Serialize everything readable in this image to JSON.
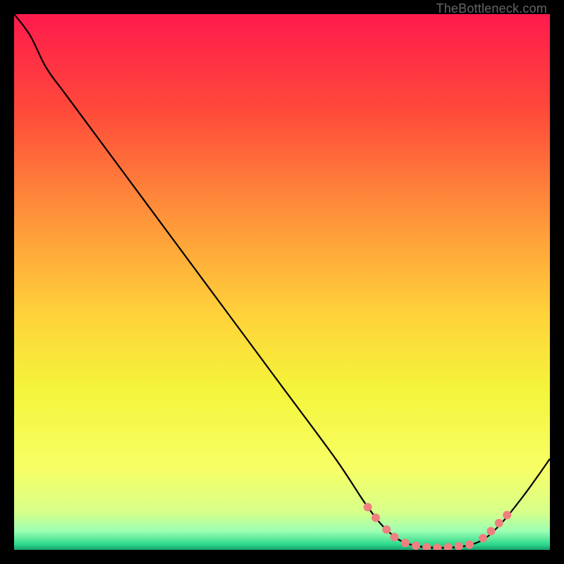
{
  "watermark": "TheBottleneck.com",
  "chart_data": {
    "type": "line",
    "title": "",
    "xlabel": "",
    "ylabel": "",
    "xlim": [
      0,
      100
    ],
    "ylim": [
      0,
      100
    ],
    "grid": false,
    "legend": false,
    "background_gradient": {
      "stops": [
        {
          "offset": 0.0,
          "color": "#ff1a4d"
        },
        {
          "offset": 0.18,
          "color": "#ff4a3a"
        },
        {
          "offset": 0.38,
          "color": "#ff943a"
        },
        {
          "offset": 0.56,
          "color": "#ffd23a"
        },
        {
          "offset": 0.7,
          "color": "#f4f43a"
        },
        {
          "offset": 0.85,
          "color": "#f7ff66"
        },
        {
          "offset": 0.93,
          "color": "#d6ff8a"
        },
        {
          "offset": 0.965,
          "color": "#9dffb3"
        },
        {
          "offset": 0.99,
          "color": "#2cd98c"
        },
        {
          "offset": 1.0,
          "color": "#1a9e6e"
        }
      ]
    },
    "curve": [
      {
        "x": 0.0,
        "y": 100.0
      },
      {
        "x": 3.0,
        "y": 96.0
      },
      {
        "x": 6.0,
        "y": 90.0
      },
      {
        "x": 10.0,
        "y": 84.5
      },
      {
        "x": 20.0,
        "y": 71.0
      },
      {
        "x": 30.0,
        "y": 57.5
      },
      {
        "x": 40.0,
        "y": 44.0
      },
      {
        "x": 50.0,
        "y": 30.5
      },
      {
        "x": 60.0,
        "y": 17.0
      },
      {
        "x": 66.0,
        "y": 8.0
      },
      {
        "x": 70.0,
        "y": 3.3
      },
      {
        "x": 74.0,
        "y": 1.0
      },
      {
        "x": 80.0,
        "y": 0.4
      },
      {
        "x": 86.0,
        "y": 1.2
      },
      {
        "x": 90.0,
        "y": 4.0
      },
      {
        "x": 95.0,
        "y": 10.0
      },
      {
        "x": 100.0,
        "y": 17.0
      }
    ],
    "highlight_points": [
      {
        "x": 66.0,
        "y": 8.0
      },
      {
        "x": 67.5,
        "y": 6.0
      },
      {
        "x": 69.5,
        "y": 3.8
      },
      {
        "x": 71.0,
        "y": 2.4
      },
      {
        "x": 73.0,
        "y": 1.3
      },
      {
        "x": 75.0,
        "y": 0.8
      },
      {
        "x": 77.0,
        "y": 0.5
      },
      {
        "x": 79.0,
        "y": 0.4
      },
      {
        "x": 81.0,
        "y": 0.5
      },
      {
        "x": 83.0,
        "y": 0.7
      },
      {
        "x": 85.0,
        "y": 1.0
      },
      {
        "x": 87.5,
        "y": 2.2
      },
      {
        "x": 89.0,
        "y": 3.5
      },
      {
        "x": 90.5,
        "y": 5.0
      },
      {
        "x": 92.0,
        "y": 6.5
      }
    ],
    "highlight_color": "#f08080"
  }
}
